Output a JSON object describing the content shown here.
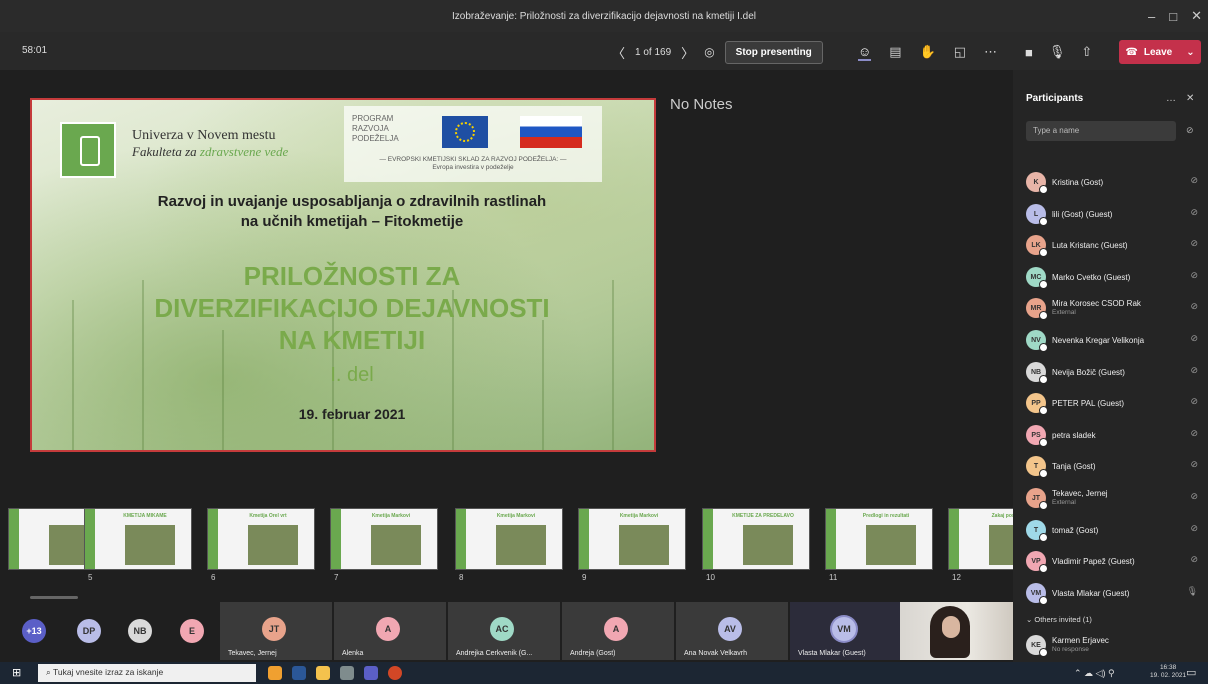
{
  "window": {
    "title": "Izobraževanje: Priložnosti za diverzifikacijo dejavnosti na kmetiji I.del",
    "minimize": "–",
    "maximize": "□",
    "close": "✕"
  },
  "toolbar": {
    "timer": "58:01",
    "pager": "1 of 169",
    "prev": "〈",
    "next": "〉",
    "stop_presenting": "Stop presenting",
    "leave": "Leave"
  },
  "slide": {
    "university": "Univerza v Novem mestu",
    "faculty_prefix": "Fakulteta za ",
    "faculty_suffix": "zdravstvene vede",
    "program_line1": "PROGRAM",
    "program_line2": "RAZVOJA",
    "program_line3": "PODEŽELJA",
    "eafrd_line1": "— EVROPSKI KMETIJSKI SKLAD ZA RAZVOJ PODEŽELJA: —",
    "eafrd_line2": "Evropa investira v podeželje",
    "subtitle_line1": "Razvoj in uvajanje usposabljanja o zdravilnih rastlinah",
    "subtitle_line2": "na učnih kmetijah – Fitokmetije",
    "title_line1": "PRILOŽNOSTI ZA",
    "title_line2": "DIVERZIFIKACIJO DEJAVNOSTI",
    "title_line3": "NA KMETIJI",
    "part": "I. del",
    "date": "19. februar 2021"
  },
  "notes": "No Notes",
  "thumbnails": [
    {
      "num": "",
      "title": ""
    },
    {
      "num": "5",
      "title": "KMETIJA MIKAME"
    },
    {
      "num": "6",
      "title": "Kmetija Orel vrt"
    },
    {
      "num": "7",
      "title": "Kmetija Markovi"
    },
    {
      "num": "8",
      "title": "Kmetija Markovi"
    },
    {
      "num": "9",
      "title": "Kmetija Markovi"
    },
    {
      "num": "10",
      "title": "KMETIJE ZA PREDELAVO"
    },
    {
      "num": "11",
      "title": "Predlogi in rezultati"
    },
    {
      "num": "12",
      "title": "Zakaj poseben"
    }
  ],
  "gallery": {
    "overflow": "+13",
    "avatars": [
      "DP",
      "NB",
      "E"
    ],
    "tiles": [
      {
        "initials": "JT",
        "name": "Tekavec, Jernej",
        "color": "#e8a38b"
      },
      {
        "initials": "A",
        "name": "Alenka",
        "color": "#f1a7b2"
      },
      {
        "initials": "AC",
        "name": "Andrejka Cerkvenik (G...",
        "color": "#9fd9c6"
      },
      {
        "initials": "A",
        "name": "Andreja (Gost)",
        "color": "#f1a7b2"
      },
      {
        "initials": "AV",
        "name": "Ana Novak Velkavrh",
        "color": "#b9bde8"
      },
      {
        "initials": "VM",
        "name": "Vlasta Mlakar (Guest)",
        "color": "#b9bde8"
      }
    ]
  },
  "participants": {
    "title": "Participants",
    "more": "…",
    "close": "✕",
    "search_placeholder": "Type a name",
    "list": [
      {
        "initials": "K",
        "name": "Kristina (Gost)",
        "sub": "",
        "color": "#e8b5a8"
      },
      {
        "initials": "L",
        "name": "lili (Gost) (Guest)",
        "sub": "",
        "color": "#b9bde8"
      },
      {
        "initials": "LK",
        "name": "Luta Kristanc (Guest)",
        "sub": "",
        "color": "#e8a38b"
      },
      {
        "initials": "MC",
        "name": "Marko Cvetko (Guest)",
        "sub": "",
        "color": "#9fd9c6"
      },
      {
        "initials": "MR",
        "name": "Mira Korosec CSOD Rak",
        "sub": "External",
        "color": "#e8a38b"
      },
      {
        "initials": "NV",
        "name": "Nevenka Kregar Velikonja",
        "sub": "",
        "color": "#9fd9c6"
      },
      {
        "initials": "NB",
        "name": "Nevija Božič (Guest)",
        "sub": "",
        "color": "#d9d9d9"
      },
      {
        "initials": "PP",
        "name": "PETER PAL (Guest)",
        "sub": "",
        "color": "#f3c58b"
      },
      {
        "initials": "PS",
        "name": "petra sladek",
        "sub": "",
        "color": "#f1a7b2"
      },
      {
        "initials": "T",
        "name": "Tanja (Gost)",
        "sub": "",
        "color": "#f3c58b"
      },
      {
        "initials": "JT",
        "name": "Tekavec, Jernej",
        "sub": "External",
        "color": "#e8a38b"
      },
      {
        "initials": "T",
        "name": "tomaž (Gost)",
        "sub": "",
        "color": "#9fd9e8"
      },
      {
        "initials": "VP",
        "name": "Vladimir Papež (Guest)",
        "sub": "",
        "color": "#f1a7b2"
      },
      {
        "initials": "VM",
        "name": "Vlasta Mlakar (Guest)",
        "sub": "",
        "color": "#b9bde8"
      }
    ],
    "others_invited": "Others invited (1)",
    "invited": {
      "initials": "KE",
      "name": "Karmen Erjavec",
      "sub": "No response"
    }
  },
  "taskbar": {
    "search": "Tukaj vnesite izraz za iskanje",
    "time": "16:38",
    "date": "19. 02. 2021"
  },
  "colors": {
    "leave": "#c4314b",
    "accent_green": "#6aa84f"
  }
}
